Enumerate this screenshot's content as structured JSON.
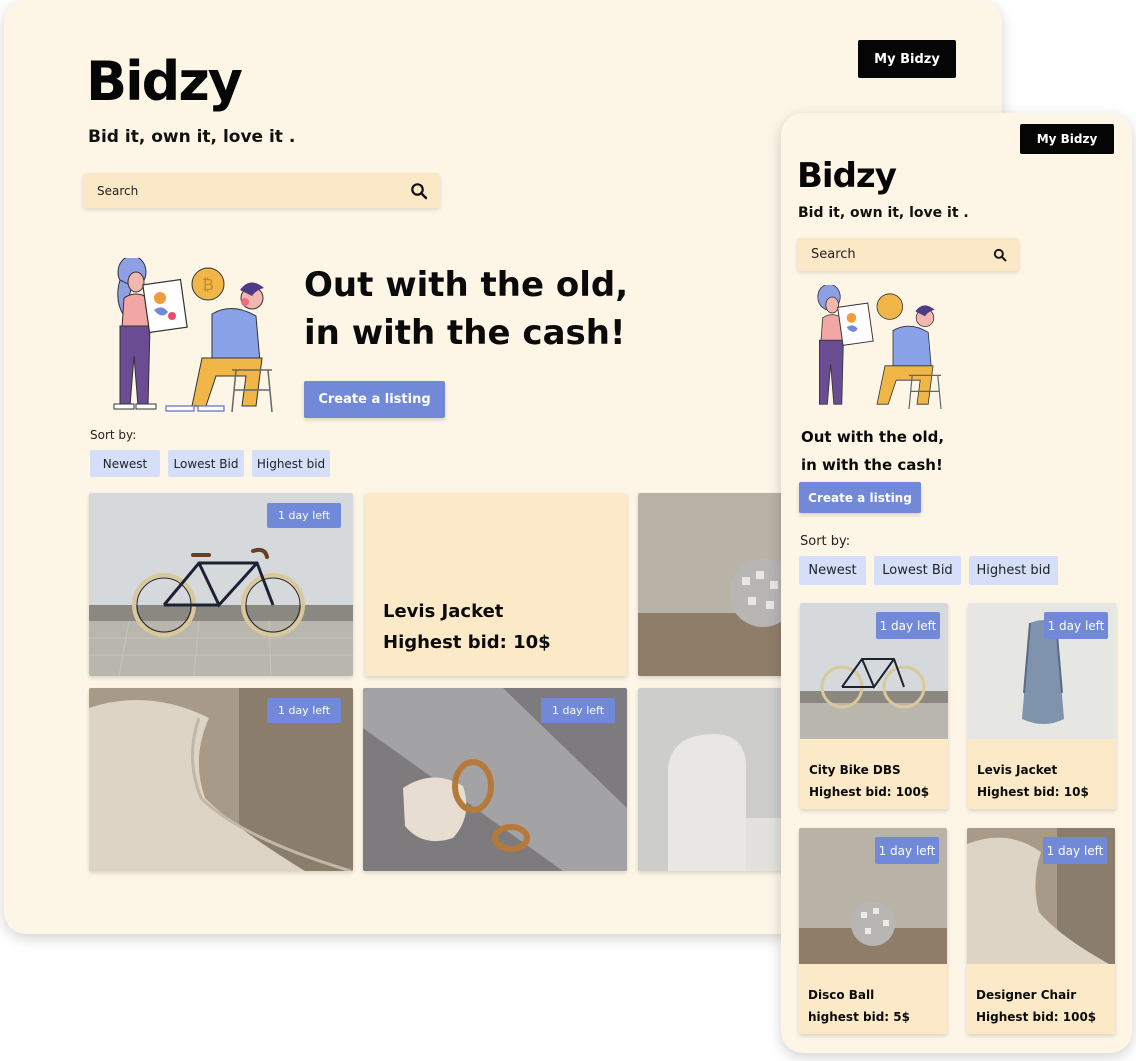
{
  "brand": {
    "logo": "Bidzy",
    "tagline": "Bid it, own it, love it ."
  },
  "nav": {
    "my_bidzy": "My Bidzy"
  },
  "search": {
    "placeholder": "Search"
  },
  "hero": {
    "line1": "Out with the old,",
    "line2": "in with the cash!",
    "cta": "Create a listing"
  },
  "sort": {
    "label": "Sort by:",
    "options": [
      "Newest",
      "Lowest Bid",
      "Highest bid"
    ]
  },
  "badge_text": "1 day left",
  "desktop_cards": [
    {
      "kind": "bike",
      "badge": "1 day left"
    },
    {
      "kind": "text",
      "name": "Levis Jacket",
      "bid": "Highest bid: 10$"
    },
    {
      "kind": "disco"
    },
    {
      "kind": "chair",
      "badge": "1 day left"
    },
    {
      "kind": "earrings",
      "badge": "1 day left"
    },
    {
      "kind": "sofa"
    }
  ],
  "mobile_cards": [
    {
      "kind": "bike",
      "badge": "1 day left",
      "name": "City Bike DBS",
      "bid": "Highest bid: 100$"
    },
    {
      "kind": "jacket",
      "badge": "1 day left",
      "name": "Levis Jacket",
      "bid": "Highest bid: 10$"
    },
    {
      "kind": "disco",
      "badge": "1 day left",
      "name": "Disco Ball",
      "bid": "highest bid: 5$"
    },
    {
      "kind": "chair",
      "badge": "1 day left",
      "name": "Designer Chair",
      "bid": "Highest bid: 100$"
    }
  ],
  "colors": {
    "page_bg": "#fdf5e6",
    "accent": "#7189d8",
    "chip": "#d6dff9",
    "card_info": "#fce9c7",
    "button_dark": "#050505"
  }
}
